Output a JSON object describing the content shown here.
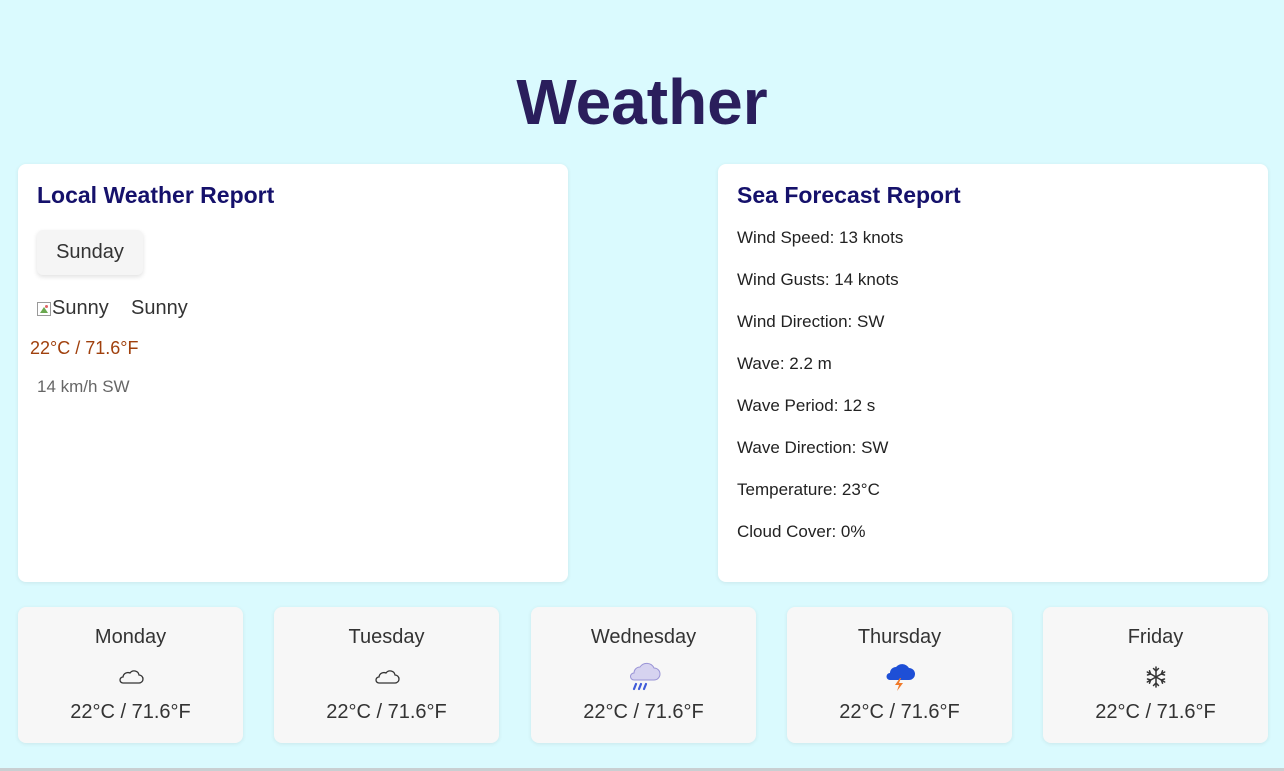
{
  "page": {
    "title": "Weather"
  },
  "local": {
    "title": "Local Weather Report",
    "day": "Sunday",
    "image_alt": "Sunny",
    "condition": "Sunny",
    "temperature": "22°C / 71.6°F",
    "wind": "14 km/h SW"
  },
  "sea": {
    "title": "Sea Forecast Report",
    "items": [
      "Wind Speed: 13 knots",
      "Wind Gusts: 14 knots",
      "Wind Direction: SW",
      "Wave: 2.2 m",
      "Wave Period: 12 s",
      "Wave Direction: SW",
      "Temperature: 23°C",
      "Cloud Cover: 0%"
    ]
  },
  "forecast": [
    {
      "day": "Monday",
      "icon": "cloud-outline-icon",
      "temperature": "22°C / 71.6°F"
    },
    {
      "day": "Tuesday",
      "icon": "cloud-outline-icon",
      "temperature": "22°C / 71.6°F"
    },
    {
      "day": "Wednesday",
      "icon": "rain-cloud-icon",
      "temperature": "22°C / 71.6°F"
    },
    {
      "day": "Thursday",
      "icon": "thunderstorm-icon",
      "temperature": "22°C / 71.6°F"
    },
    {
      "day": "Friday",
      "icon": "snowflake-icon",
      "temperature": "22°C / 71.6°F"
    }
  ],
  "colors": {
    "background": "#dafafe",
    "page_title": "#2a1e5c",
    "card_title": "#15116b",
    "temperature_accent": "#a0400d"
  }
}
